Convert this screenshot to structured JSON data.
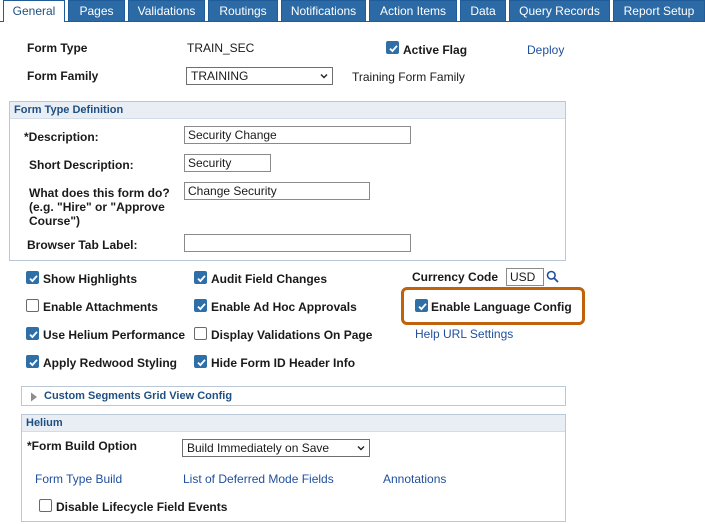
{
  "tabs": [
    {
      "label": "General",
      "active": true
    },
    {
      "label": "Pages",
      "active": false
    },
    {
      "label": "Validations",
      "active": false
    },
    {
      "label": "Routings",
      "active": false
    },
    {
      "label": "Notifications",
      "active": false
    },
    {
      "label": "Action Items",
      "active": false
    },
    {
      "label": "Data",
      "active": false
    },
    {
      "label": "Query Records",
      "active": false
    },
    {
      "label": "Report Setup",
      "active": false
    }
  ],
  "header": {
    "form_type_label": "Form Type",
    "form_type_value": "TRAIN_SEC",
    "active_flag_label": "Active Flag",
    "active_flag_checked": true,
    "deploy_link": "Deploy",
    "form_family_label": "Form Family",
    "form_family_value": "TRAINING",
    "form_family_description": "Training Form Family"
  },
  "definition": {
    "title": "Form Type Definition",
    "description_label": "*Description:",
    "description_value": "Security Change",
    "short_description_label": "Short Description:",
    "short_description_value": "Security",
    "what_does_label_1": "What does this form do?",
    "what_does_label_2": "(e.g. \"Hire\" or \"Approve",
    "what_does_label_3": "Course\")",
    "what_does_value": "Change Security",
    "browser_tab_label": "Browser Tab Label:",
    "browser_tab_value": ""
  },
  "options": {
    "show_highlights": {
      "label": "Show Highlights",
      "checked": true
    },
    "audit_field_changes": {
      "label": "Audit Field Changes",
      "checked": true
    },
    "currency_code_label": "Currency Code",
    "currency_code_value": "USD",
    "enable_attachments": {
      "label": "Enable Attachments",
      "checked": false
    },
    "enable_ad_hoc": {
      "label": "Enable Ad Hoc Approvals",
      "checked": true
    },
    "enable_language_config": {
      "label": "Enable Language Config",
      "checked": true
    },
    "use_helium": {
      "label": "Use Helium Performance",
      "checked": true
    },
    "display_validations": {
      "label": "Display Validations On Page",
      "checked": false
    },
    "help_url_settings": "Help URL Settings",
    "apply_redwood": {
      "label": "Apply Redwood Styling",
      "checked": true
    },
    "hide_form_id": {
      "label": "Hide Form ID Header Info",
      "checked": true
    }
  },
  "custom_segments": {
    "title": "Custom Segments Grid View Config"
  },
  "helium": {
    "title": "Helium",
    "build_option_label": "*Form Build Option",
    "build_option_value": "Build Immediately on Save",
    "form_type_build_link": "Form Type Build",
    "deferred_fields_link": "List of Deferred Mode Fields",
    "annotations_link": "Annotations",
    "disable_lifecycle": {
      "label": "Disable Lifecycle Field Events",
      "checked": false
    }
  },
  "colors": {
    "accent": "#2c6aa6",
    "link": "#1f4f9e",
    "highlight": "#c0620d",
    "checkbox": "#2f6fa8"
  }
}
